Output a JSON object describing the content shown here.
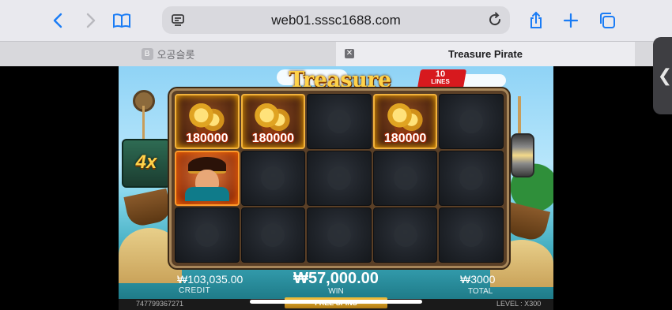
{
  "browser": {
    "url": "web01.sssc1688.com",
    "tabs": [
      {
        "label": "오공슬롯",
        "favicon": "B",
        "active": false
      },
      {
        "label": "Treasure Pirate",
        "active": true
      }
    ],
    "icons": [
      "back-icon",
      "forward-icon",
      "bookmarks-icon",
      "reader-icon",
      "reload-icon",
      "share-icon",
      "new-tab-icon",
      "tabs-icon"
    ],
    "accent": "#1a7cf5"
  },
  "game": {
    "title": "Treasure Pirate",
    "lines_number": "10",
    "lines_label": "LINES",
    "multiplier": "4x",
    "reels": [
      [
        {
          "type": "gold",
          "value": "180000"
        },
        {
          "type": "gold",
          "value": "180000"
        },
        {
          "type": "empty"
        },
        {
          "type": "gold",
          "value": "180000"
        },
        {
          "type": "empty"
        }
      ],
      [
        {
          "type": "pirate"
        },
        {
          "type": "empty"
        },
        {
          "type": "empty"
        },
        {
          "type": "empty"
        },
        {
          "type": "empty"
        }
      ],
      [
        {
          "type": "empty"
        },
        {
          "type": "empty"
        },
        {
          "type": "empty"
        },
        {
          "type": "empty"
        },
        {
          "type": "empty"
        }
      ]
    ],
    "credit_value": "₩103,035.00",
    "credit_label": "CREDIT",
    "win_value": "₩57,000.00",
    "win_label": "WIN",
    "total_value": "₩3000",
    "total_label": "TOTAL",
    "session_id": "747799367271",
    "free_spins_label": "FREE SPINS",
    "level_label": "LEVEL : X300"
  }
}
